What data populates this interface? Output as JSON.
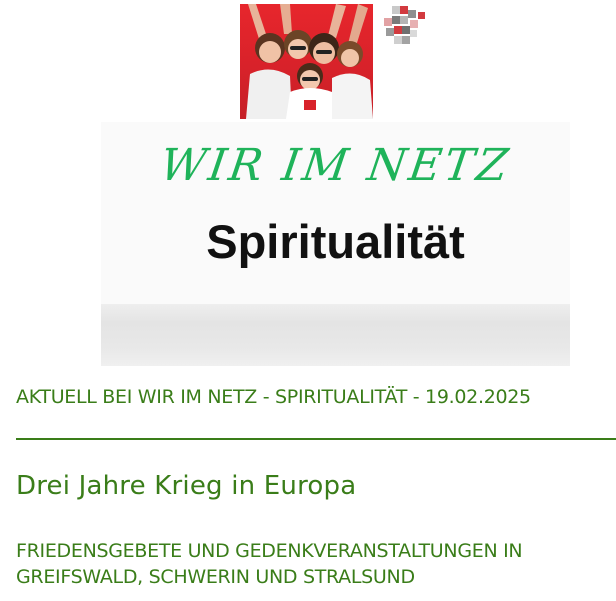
{
  "banner": {
    "script_title": "WIR IM NETZ",
    "title": "Spiritualität"
  },
  "article": {
    "kicker": "AKTUELL BEI WIR IM NETZ - SPIRITUALITÄT - 19.02.2025",
    "headline": "Drei Jahre Krieg in Europa",
    "subheadline": "FRIEDENSGEBETE UND GEDENKVERANSTALTUNGEN IN GREIFSWALD, SCHWERIN UND STRALSUND"
  },
  "colors": {
    "accent_green": "#3a7d19",
    "script_green": "#1fb35a",
    "photo_red": "#e7262c",
    "title_black": "#111111"
  }
}
